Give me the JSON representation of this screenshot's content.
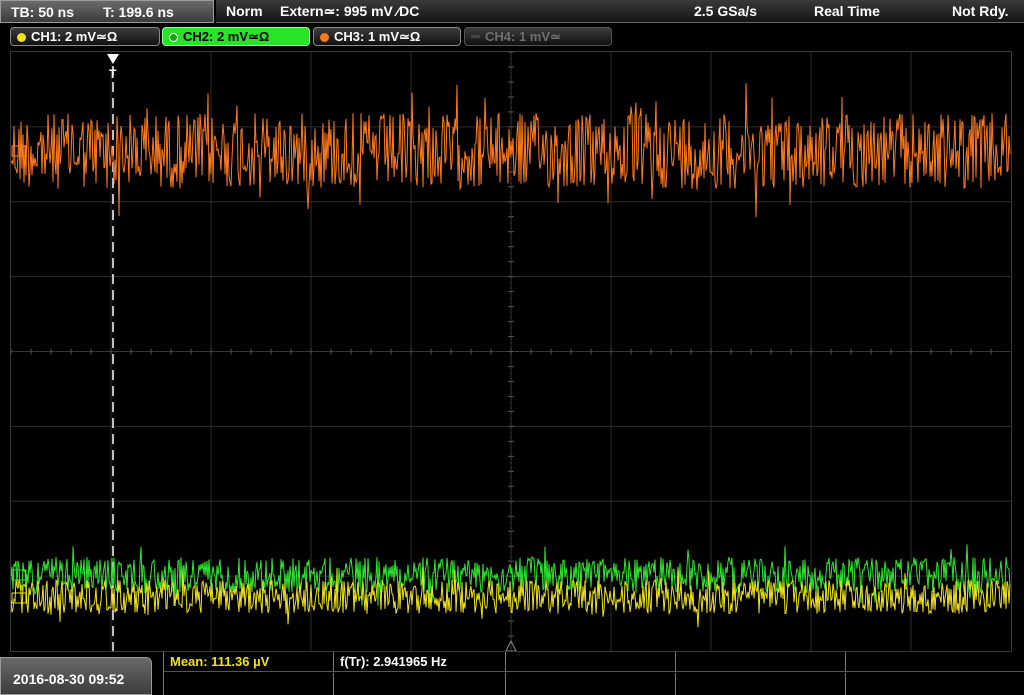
{
  "topbar": {
    "timebase": "TB: 50 ns",
    "trigger_time": "T: 199.6 ns",
    "trigger_mode": "Norm",
    "trigger_source": "Extern≃: 995 mV ⁄DC",
    "sample_rate": "2.5 GSa/s",
    "acq_mode": "Real Time",
    "status": "Not Rdy."
  },
  "channels": [
    {
      "label": "CH1: 2 mV≃Ω",
      "color": "#f0e21b",
      "active": false,
      "enabled": true
    },
    {
      "label": "CH2: 2 mV≃Ω",
      "color": "#2ee62e",
      "active": true,
      "enabled": true
    },
    {
      "label": "CH3: 1 mV≃Ω",
      "color": "#ff7a1e",
      "active": false,
      "enabled": true
    },
    {
      "label": "CH4: 1 mV≃",
      "color": "#6f6f6f",
      "active": false,
      "enabled": false
    }
  ],
  "trigger_marker": "T",
  "colors": {
    "ch1": "#f0e21b",
    "ch2": "#2ee62e",
    "ch3": "#ff7a1e",
    "grid": "#2e2e2e"
  },
  "bottom": {
    "datetime": "2016-08-30 09:52",
    "measurements": [
      {
        "label": "Mean: 111.36 µV",
        "color": "#f0e21b"
      },
      {
        "label": "f(Tr): 2.941965 Hz",
        "color": "#ffffff"
      }
    ]
  }
}
